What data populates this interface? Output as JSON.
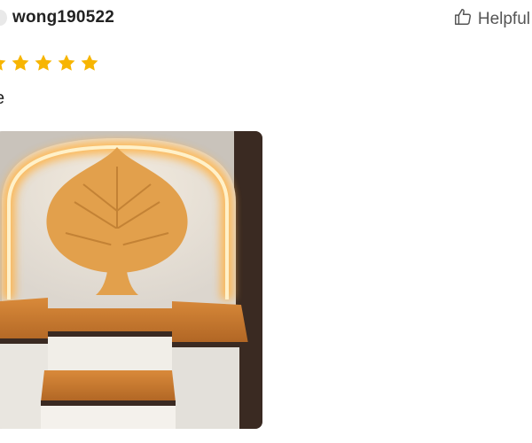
{
  "review": {
    "username": "wong190522",
    "helpful_label": "Helpful",
    "rating": 5,
    "rating_max": 5,
    "text": "e"
  },
  "icons": {
    "helpful": "thumbs-up-icon",
    "rating_star": "star-icon"
  },
  "colors": {
    "star": "#f7b500",
    "username": "#222222",
    "helpful": "#555555"
  }
}
